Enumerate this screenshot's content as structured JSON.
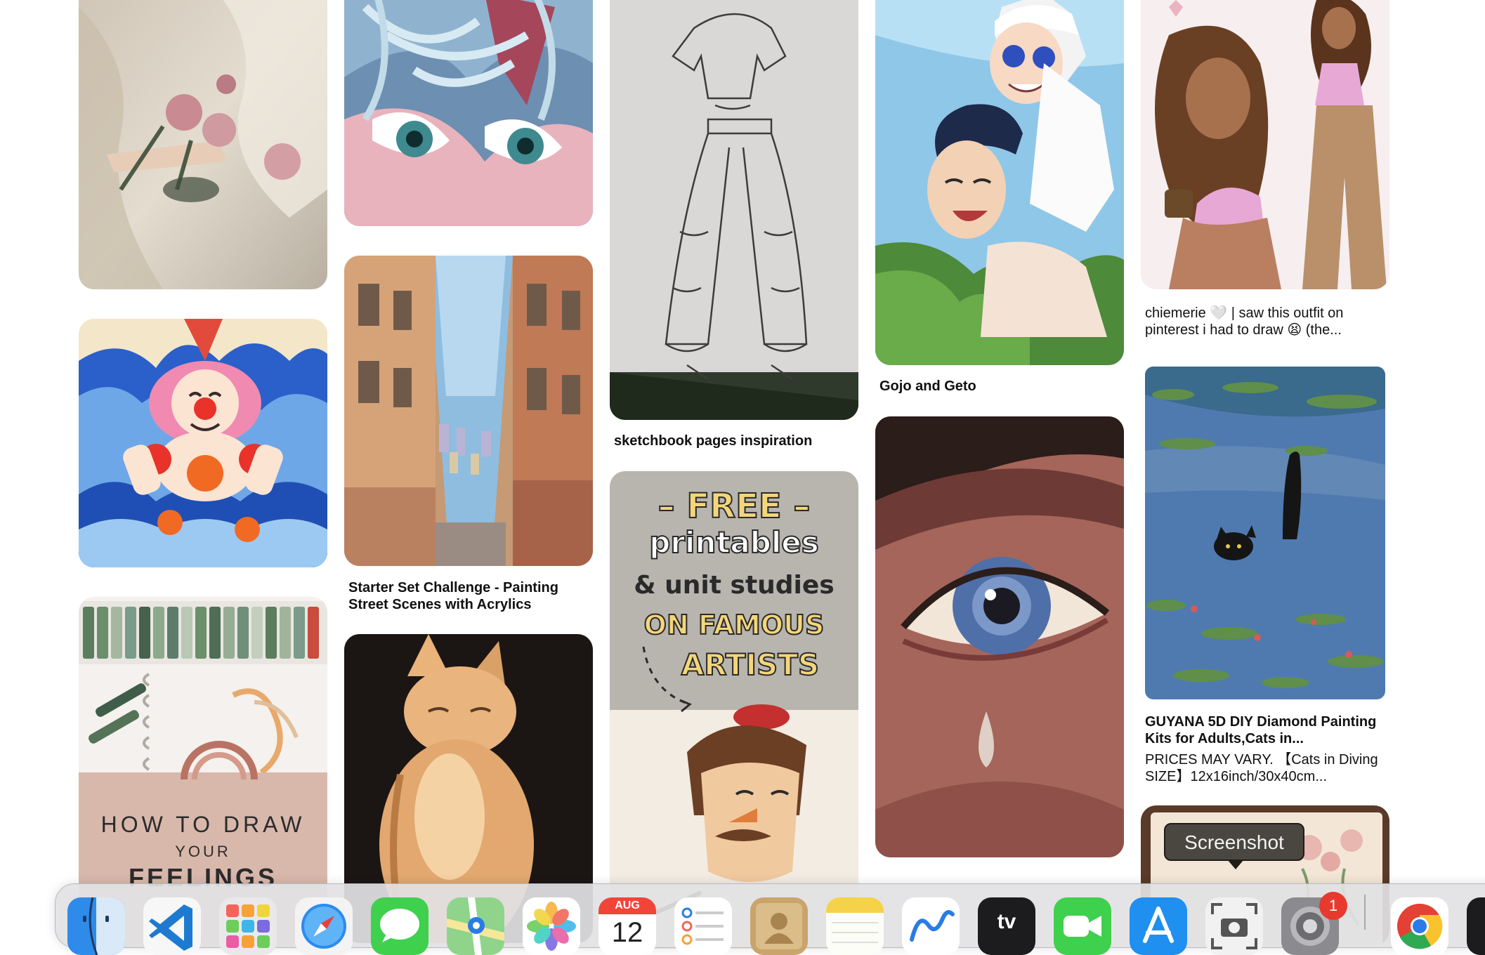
{
  "pins": {
    "col1": [
      {
        "name": "lace-roses-painting"
      },
      {
        "name": "clown-illustration"
      },
      {
        "name": "how-to-draw-feelings",
        "overlay": [
          "HOW TO DRAW",
          "YOUR",
          "FEELINGS"
        ]
      }
    ],
    "col2": [
      {
        "name": "anime-eyes-closeup"
      },
      {
        "name": "street-painting",
        "title": "Starter Set Challenge - Painting Street Scenes with Acrylics"
      },
      {
        "name": "orange-cat-painting"
      }
    ],
    "col3": [
      {
        "name": "pants-sketch",
        "title": "sketchbook pages inspiration"
      },
      {
        "name": "free-printables",
        "overlay": [
          "– FREE –",
          "printables",
          "& unit studies",
          "ON FAMOUS",
          "ARTISTS"
        ]
      }
    ],
    "col4": [
      {
        "name": "gojo-geto",
        "title": "Gojo and Geto"
      },
      {
        "name": "teary-eye-painting"
      }
    ],
    "col5": [
      {
        "name": "outfit-drawing",
        "text": "chiemerie 🤍 | saw this outfit on pinterest i had to draw 😫 (the..."
      },
      {
        "name": "cat-in-pond",
        "title": "GUYANA 5D DIY Diamond Painting Kits for Adults,Cats in...",
        "desc": "PRICES MAY VARY. 【Cats in Diving SIZE】12x16inch/30x40cm..."
      },
      {
        "name": "floral-sketchbook"
      }
    ]
  },
  "dock": {
    "tooltip": "Screenshot",
    "calendar_month": "AUG",
    "calendar_day": "12",
    "appletv_label": "tv",
    "settings_badge": "1",
    "apps": [
      "finder",
      "vscode",
      "launchpad",
      "safari",
      "messages",
      "maps",
      "photos",
      "calendar",
      "reminders",
      "contacts",
      "notes",
      "freeform",
      "appletv",
      "facetime",
      "appstore",
      "screenshot",
      "system-settings",
      "chrome",
      "terminal"
    ]
  }
}
